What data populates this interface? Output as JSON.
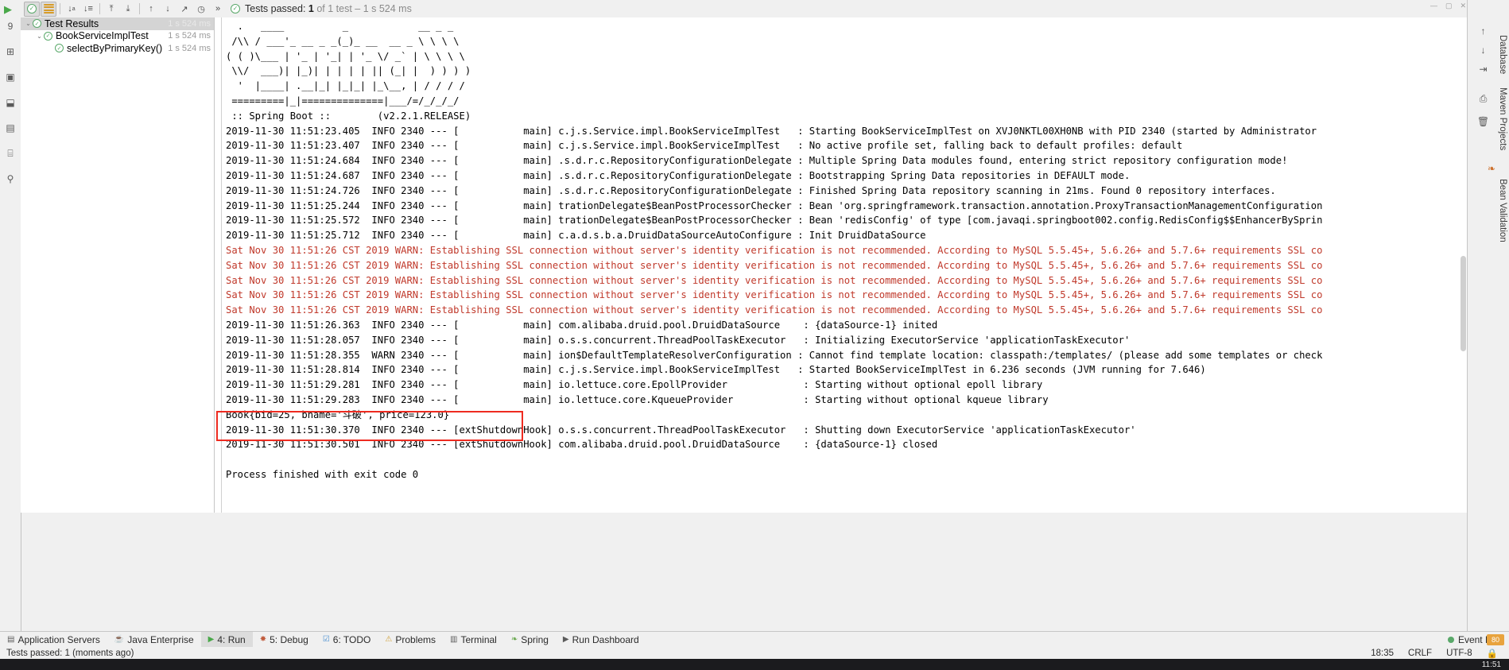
{
  "toolbar": {
    "run_icon": "play-icon",
    "status": {
      "prefix": "Tests passed: ",
      "count": "1",
      "suffix": " of 1 test – 1 s 524 ms"
    },
    "buttons": [
      {
        "name": "show-passed-toggle",
        "glyph": "✔"
      },
      {
        "name": "show-ignored-toggle",
        "glyph": "≡"
      },
      {
        "name": "sort-alphabetically",
        "glyph": "↓a"
      },
      {
        "name": "sort-by-duration",
        "glyph": "↓≡"
      },
      {
        "name": "expand-all",
        "glyph": "⤒"
      },
      {
        "name": "collapse-all",
        "glyph": "⤓"
      },
      {
        "name": "previous-failed-test",
        "glyph": "↑"
      },
      {
        "name": "next-failed-test",
        "glyph": "↓"
      },
      {
        "name": "export-test-results",
        "glyph": "↗"
      },
      {
        "name": "test-history",
        "glyph": "🕐"
      },
      {
        "name": "more-options",
        "glyph": "»"
      }
    ]
  },
  "test_tree": {
    "rows": [
      {
        "indent": 0,
        "arrow": "⌄",
        "label": "Test Results",
        "time": "1 s 524 ms",
        "selected": true
      },
      {
        "indent": 1,
        "arrow": "⌄",
        "label": "BookServiceImplTest",
        "time": "1 s 524 ms",
        "selected": false
      },
      {
        "indent": 2,
        "arrow": "",
        "label": "selectByPrimaryKey()",
        "time": "1 s 524 ms",
        "selected": false
      }
    ]
  },
  "console": {
    "banner": [
      "  .   ____          _            __ _ _",
      " /\\\\ / ___'_ __ _ _(_)_ __  __ _ \\ \\ \\ \\",
      "( ( )\\___ | '_ | '_| | '_ \\/ _` | \\ \\ \\ \\",
      " \\\\/  ___)| |_)| | | | | || (_| |  ) ) ) )",
      "  '  |____| .__|_| |_|_| |_\\__, | / / / /",
      " =========|_|==============|___/=/_/_/_/",
      " :: Spring Boot ::        (v2.2.1.RELEASE)",
      ""
    ],
    "lines": [
      {
        "kind": "info",
        "text": "2019-11-30 11:51:23.405  INFO 2340 --- [           main] c.j.s.Service.impl.BookServiceImplTest   : Starting BookServiceImplTest on XVJ0NKTL00XH0NB with PID 2340 (started by Administrator"
      },
      {
        "kind": "info",
        "text": "2019-11-30 11:51:23.407  INFO 2340 --- [           main] c.j.s.Service.impl.BookServiceImplTest   : No active profile set, falling back to default profiles: default"
      },
      {
        "kind": "info",
        "text": "2019-11-30 11:51:24.684  INFO 2340 --- [           main] .s.d.r.c.RepositoryConfigurationDelegate : Multiple Spring Data modules found, entering strict repository configuration mode!"
      },
      {
        "kind": "info",
        "text": "2019-11-30 11:51:24.687  INFO 2340 --- [           main] .s.d.r.c.RepositoryConfigurationDelegate : Bootstrapping Spring Data repositories in DEFAULT mode."
      },
      {
        "kind": "info",
        "text": "2019-11-30 11:51:24.726  INFO 2340 --- [           main] .s.d.r.c.RepositoryConfigurationDelegate : Finished Spring Data repository scanning in 21ms. Found 0 repository interfaces."
      },
      {
        "kind": "info",
        "text": "2019-11-30 11:51:25.244  INFO 2340 --- [           main] trationDelegate$BeanPostProcessorChecker : Bean 'org.springframework.transaction.annotation.ProxyTransactionManagementConfiguration"
      },
      {
        "kind": "info",
        "text": "2019-11-30 11:51:25.572  INFO 2340 --- [           main] trationDelegate$BeanPostProcessorChecker : Bean 'redisConfig' of type [com.javaqi.springboot002.config.RedisConfig$$EnhancerBySprin"
      },
      {
        "kind": "info",
        "text": "2019-11-30 11:51:25.712  INFO 2340 --- [           main] c.a.d.s.b.a.DruidDataSourceAutoConfigure : Init DruidDataSource"
      },
      {
        "kind": "warn",
        "text": "Sat Nov 30 11:51:26 CST 2019 WARN: Establishing SSL connection without server's identity verification is not recommended. According to MySQL 5.5.45+, 5.6.26+ and 5.7.6+ requirements SSL co"
      },
      {
        "kind": "warn",
        "text": "Sat Nov 30 11:51:26 CST 2019 WARN: Establishing SSL connection without server's identity verification is not recommended. According to MySQL 5.5.45+, 5.6.26+ and 5.7.6+ requirements SSL co"
      },
      {
        "kind": "warn",
        "text": "Sat Nov 30 11:51:26 CST 2019 WARN: Establishing SSL connection without server's identity verification is not recommended. According to MySQL 5.5.45+, 5.6.26+ and 5.7.6+ requirements SSL co"
      },
      {
        "kind": "warn",
        "text": "Sat Nov 30 11:51:26 CST 2019 WARN: Establishing SSL connection without server's identity verification is not recommended. According to MySQL 5.5.45+, 5.6.26+ and 5.7.6+ requirements SSL co"
      },
      {
        "kind": "warn",
        "text": "Sat Nov 30 11:51:26 CST 2019 WARN: Establishing SSL connection without server's identity verification is not recommended. According to MySQL 5.5.45+, 5.6.26+ and 5.7.6+ requirements SSL co"
      },
      {
        "kind": "info",
        "text": "2019-11-30 11:51:26.363  INFO 2340 --- [           main] com.alibaba.druid.pool.DruidDataSource    : {dataSource-1} inited"
      },
      {
        "kind": "info",
        "text": "2019-11-30 11:51:28.057  INFO 2340 --- [           main] o.s.s.concurrent.ThreadPoolTaskExecutor   : Initializing ExecutorService 'applicationTaskExecutor'"
      },
      {
        "kind": "info",
        "text": "2019-11-30 11:51:28.355  WARN 2340 --- [           main] ion$DefaultTemplateResolverConfiguration : Cannot find template location: classpath:/templates/ (please add some templates or check"
      },
      {
        "kind": "info",
        "text": "2019-11-30 11:51:28.814  INFO 2340 --- [           main] c.j.s.Service.impl.BookServiceImplTest   : Started BookServiceImplTest in 6.236 seconds (JVM running for 7.646)"
      },
      {
        "kind": "info",
        "text": "2019-11-30 11:51:29.281  INFO 2340 --- [           main] io.lettuce.core.EpollProvider             : Starting without optional epoll library"
      },
      {
        "kind": "info",
        "text": "2019-11-30 11:51:29.283  INFO 2340 --- [           main] io.lettuce.core.KqueueProvider            : Starting without optional kqueue library"
      },
      {
        "kind": "result",
        "text": "Book{bid=25, bname='斗破', price=123.0}"
      },
      {
        "kind": "info",
        "text": "2019-11-30 11:51:30.370  INFO 2340 --- [extShutdownHook] o.s.s.concurrent.ThreadPoolTaskExecutor   : Shutting down ExecutorService 'applicationTaskExecutor'"
      },
      {
        "kind": "info",
        "text": "2019-11-30 11:51:30.501  INFO 2340 --- [extShutdownHook] com.alibaba.druid.pool.DruidDataSource    : {dataSource-1} closed"
      },
      {
        "kind": "blank",
        "text": ""
      },
      {
        "kind": "info",
        "text": "Process finished with exit code 0"
      }
    ],
    "highlight_color": "#ee2b20"
  },
  "left_rail": {
    "icons": [
      {
        "name": "debugger-icon",
        "glyph": "9"
      },
      {
        "name": "structure-icon",
        "glyph": "⊞"
      },
      {
        "name": "favorites-icon",
        "glyph": "▣"
      },
      {
        "name": "build-icon",
        "glyph": "⬓"
      },
      {
        "name": "terminal-icon",
        "glyph": "▤"
      },
      {
        "name": "database-icon",
        "glyph": "⌸"
      },
      {
        "name": "pin-icon",
        "glyph": "📌"
      }
    ]
  },
  "right_rail": {
    "icons": [
      {
        "name": "scroll-up-icon",
        "glyph": "↑"
      },
      {
        "name": "scroll-down-icon",
        "glyph": "↓"
      },
      {
        "name": "soft-wrap-icon",
        "glyph": "↵"
      },
      {
        "name": "print-icon",
        "glyph": "⎙"
      },
      {
        "name": "clear-all-icon",
        "glyph": "🗑"
      }
    ],
    "tabs": [
      {
        "name": "maven-projects-tab",
        "label": "Maven Projects"
      },
      {
        "name": "bean-validation-tab",
        "label": "Bean Validation"
      },
      {
        "name": "database-tab",
        "label": "Database"
      }
    ]
  },
  "tool_window_bar": {
    "items": [
      {
        "name": "application-servers",
        "label": "Application Servers",
        "icon": "server-icon",
        "active": false
      },
      {
        "name": "java-enterprise",
        "label": "Java Enterprise",
        "icon": "java-icon",
        "active": false
      },
      {
        "name": "run",
        "label": "4: Run",
        "icon": "play-icon",
        "active": true
      },
      {
        "name": "debug",
        "label": "5: Debug",
        "icon": "bug-icon",
        "active": false
      },
      {
        "name": "todo",
        "label": "6: TODO",
        "icon": "check-icon",
        "active": false
      },
      {
        "name": "problems",
        "label": "Problems",
        "icon": "warning-icon",
        "active": false
      },
      {
        "name": "terminal",
        "label": "Terminal",
        "icon": "terminal-icon",
        "active": false
      },
      {
        "name": "spring",
        "label": "Spring",
        "icon": "leaf-icon",
        "active": false
      },
      {
        "name": "run-dashboard",
        "label": "Run Dashboard",
        "icon": "play-icon",
        "active": false
      }
    ],
    "event_log": "Event Log"
  },
  "status_bar": {
    "message": "Tests passed: 1 (moments ago)",
    "time": "18:35",
    "line_sep": "CRLF",
    "encoding": "UTF-8"
  },
  "taskbar": {
    "clock": "11:51"
  }
}
